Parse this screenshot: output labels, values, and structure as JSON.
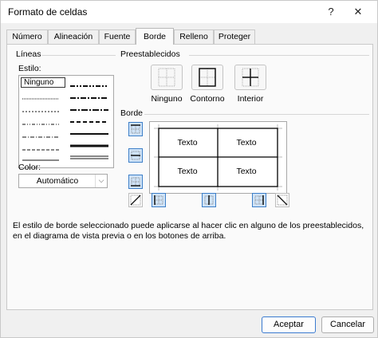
{
  "window": {
    "title": "Formato de celdas",
    "help_glyph": "?",
    "close_glyph": "✕"
  },
  "tabs": [
    {
      "label": "Número"
    },
    {
      "label": "Alineación"
    },
    {
      "label": "Fuente"
    },
    {
      "label": "Borde",
      "active": true
    },
    {
      "label": "Relleno"
    },
    {
      "label": "Proteger"
    }
  ],
  "lineas": {
    "group_title": "Líneas",
    "estilo_label": "Estilo:",
    "none_option": "Ninguno"
  },
  "color": {
    "label": "Color:",
    "value": "Automático"
  },
  "presets": {
    "group_title": "Preestablecidos",
    "items": [
      {
        "label": "Ninguno"
      },
      {
        "label": "Contorno"
      },
      {
        "label": "Interior"
      }
    ]
  },
  "borde": {
    "group_title": "Borde",
    "preview_cells": [
      "Texto",
      "Texto",
      "Texto",
      "Texto"
    ]
  },
  "description": "El estilo de borde seleccionado puede aplicarse al hacer clic en alguno de los preestablecidos, en el diagrama de vista previa o en los botones de arriba.",
  "buttons": {
    "ok": "Aceptar",
    "cancel": "Cancelar"
  },
  "colors": {
    "accent": "#3b7bd0",
    "toggle_on": "#cfe3f7"
  }
}
